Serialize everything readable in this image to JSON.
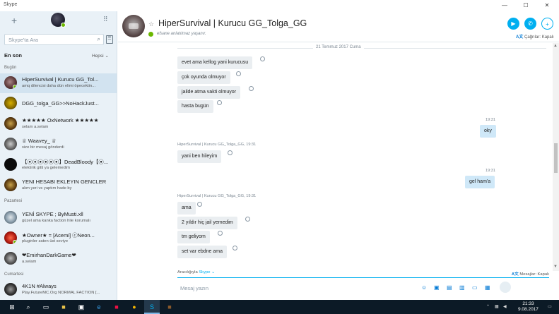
{
  "window": {
    "title": "Skype",
    "minimize": "—",
    "maximize": "☐",
    "close": "✕"
  },
  "sidebar": {
    "new_button": "+",
    "dialpad": "⠿",
    "search_placeholder": "Skype'ta Ara",
    "recent_header": "En son",
    "filter_label": "Hepsi",
    "sections": {
      "today": "Bugün",
      "monday": "Pazartesi",
      "saturday": "Cumartesi"
    },
    "chats": [
      {
        "name": "HiperSurvival | Kurucu GG_Tol...",
        "preview": "amq dilencisi daha dün elimi öpecektin...",
        "online": true
      },
      {
        "name": "DGG_tolga_GG>>NoHackJust...",
        "preview": ""
      },
      {
        "name": "★★★★★ OxNetwork ★★★★★",
        "preview": "selam a.selam"
      },
      {
        "name": "♕ Waavey_ ♕",
        "preview": "size bir mesaj gönderdi"
      },
      {
        "name": "【⦿⦿⦿⦿⦿⦿】DeadBloody【⦿...",
        "preview": "elektirik gitti ya gelemedim"
      },
      {
        "name": "YENI HESABI EKLEYIN GENCLER",
        "preview": "alım yeri vs yaptım hade by"
      },
      {
        "name": "YENİ SKYPE ; ByMusti.xll",
        "preview": "güzel ama kanka faction hile korumalı"
      },
      {
        "name": "★Owner★ = [Acemi] ⓒNeon...",
        "preview": "pluginler zaten üst seviye"
      },
      {
        "name": "❤EmirhanDarkGame❤",
        "preview": "a.selam"
      },
      {
        "name": "4K1N #Always",
        "preview": "Play.FutureMC.Org NORMAL FACTION [..."
      }
    ]
  },
  "conversation": {
    "title": "HiperSurvival | Kurucu GG_Tolga_GG",
    "status": "efsane anlatılmaz yaşanır.",
    "calls_label": "Çağrılar: Kapalı",
    "date": "21 Temmuz 2017 Cuma",
    "messages": [
      {
        "dir": "in",
        "text": "evet ama kellog yani kurucusu"
      },
      {
        "dir": "in",
        "text": "çok oyunda olmuyor"
      },
      {
        "dir": "in",
        "text": "jailde atma vakti olmuyor"
      },
      {
        "dir": "in",
        "text": "hasta bugün"
      },
      {
        "dir": "out",
        "time": "19:31",
        "text": "oky"
      },
      {
        "dir": "in",
        "sender": "HiperSurvival | Kurucu GG_Tolga_GG, 19:31",
        "text": "yani ben hileyim"
      },
      {
        "dir": "out",
        "time": "19:31",
        "text": "gel ham'a"
      },
      {
        "dir": "in",
        "sender": "HiperSurvival | Kurucu GG_Tolga_GG, 19:31",
        "text": "ama"
      },
      {
        "dir": "in",
        "text": "2 yıldır hiç jail yemedim"
      },
      {
        "dir": "in",
        "text": "tm geliyom"
      },
      {
        "dir": "in",
        "text": "set var ebdne ama"
      }
    ],
    "via_label": "Aracılığıyla",
    "via_service": "Skype",
    "messages_label": "Mesajlar: Kapalı",
    "input_placeholder": "Mesaj yazın"
  },
  "taskbar": {
    "time": "21:33",
    "date": "9.08.2017"
  },
  "colors": {
    "accent": "#00aff0",
    "online": "#6bb700",
    "incoming": "#eaeef1",
    "outgoing": "#cfe8f8"
  },
  "icons": [
    "search-icon",
    "contacts-icon",
    "video-call-icon",
    "audio-call-icon",
    "add-contact-icon",
    "translate-icon",
    "emoji-icon",
    "send-icon"
  ]
}
